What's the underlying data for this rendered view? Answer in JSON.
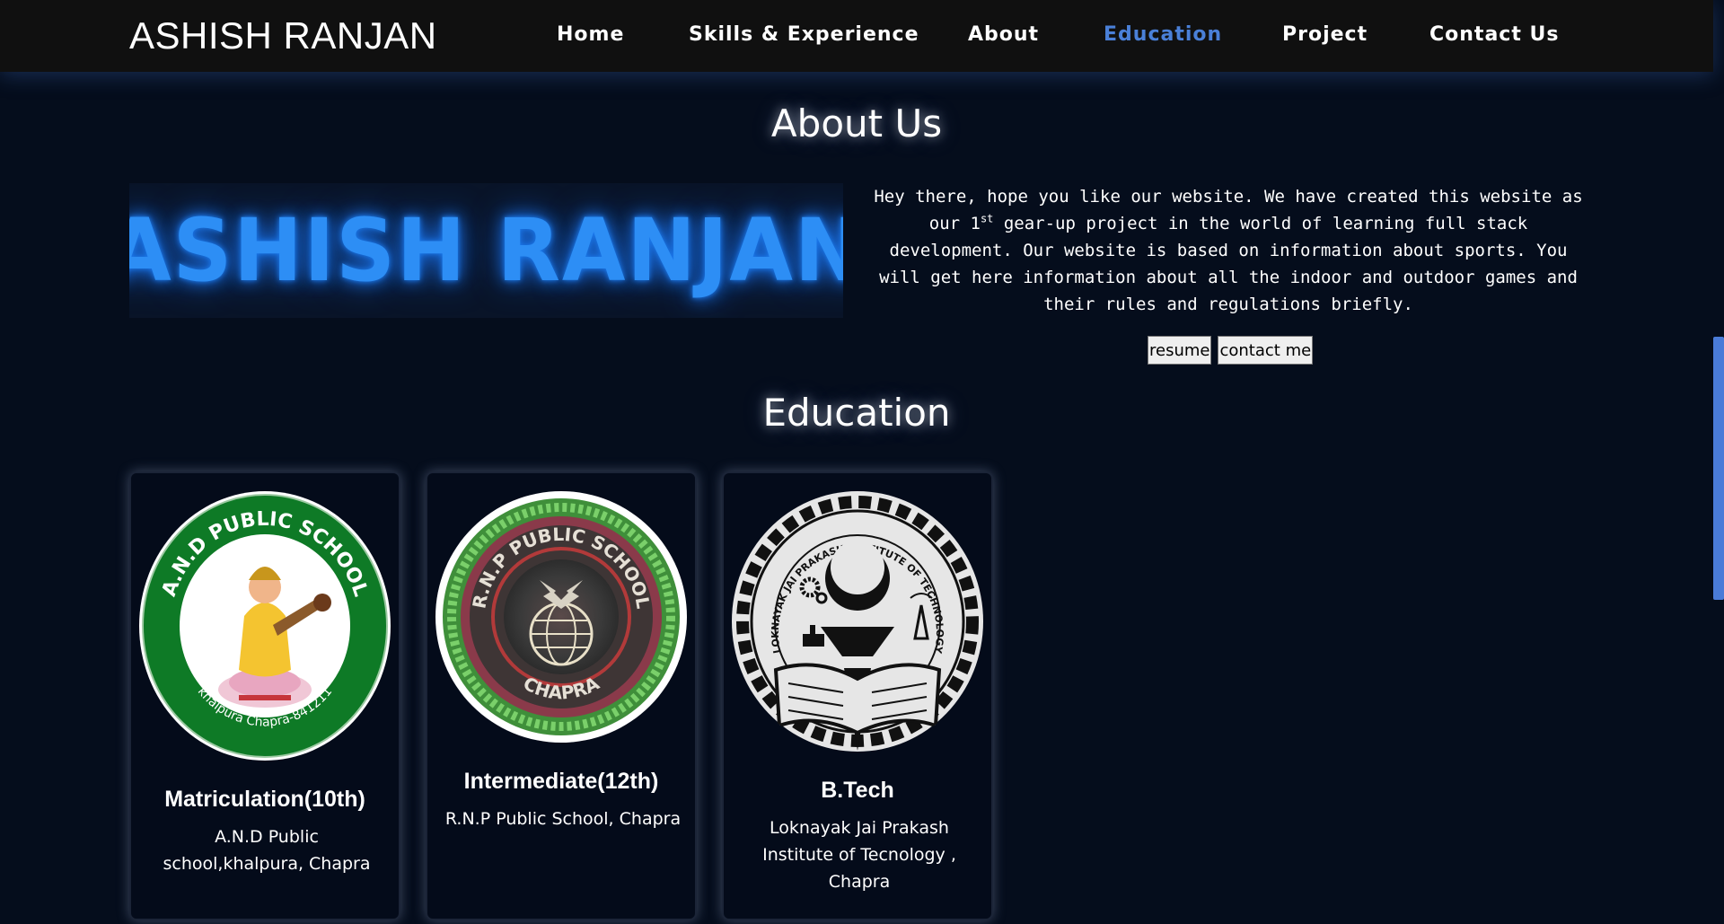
{
  "header": {
    "brand": "ASHISH RANJAN",
    "nav": [
      {
        "label": "Home"
      },
      {
        "label": "Skills & Experience"
      },
      {
        "label": "About"
      },
      {
        "label": "Education",
        "active": true
      },
      {
        "label": "Project"
      },
      {
        "label": "Contact Us"
      }
    ]
  },
  "about": {
    "title": "About Us",
    "banner_text": "ASHISH RANJAN",
    "paragraph_before_sup": "Hey there, hope you like our website. We have created this website as our 1",
    "sup": "st",
    "paragraph_after_sup": " gear-up project in the world of learning full stack development. Our website is based on information about sports. You will get here information about all the indoor and outdoor games and their rules and regulations briefly.",
    "buttons": {
      "resume": "resume",
      "contact": "contact me"
    }
  },
  "education": {
    "title": "Education",
    "cards": [
      {
        "title": "Matriculation(10th)",
        "school": "A.N.D Public school,khalpura, Chapra",
        "logo_text_top": "A.N.D PUBLIC SCHOOL",
        "logo_text_bottom": "khalpura Chapra-841211"
      },
      {
        "title": "Intermediate(12th)",
        "school": "R.N.P Public School, Chapra",
        "logo_text_top": "R.N.P PUBLIC SCHOOL",
        "logo_text_bottom": "CHAPRA"
      },
      {
        "title": "B.Tech",
        "school": "Loknayak Jai Prakash Institute of Tecnology , Chapra",
        "logo_text_top": "LOKNAYAK JAI PRAKASH INSTITUTE OF TECHNOLOGY"
      }
    ]
  },
  "colors": {
    "accent": "#4a80d8",
    "neon": "#2d8ef5",
    "background": "#050d1c"
  }
}
